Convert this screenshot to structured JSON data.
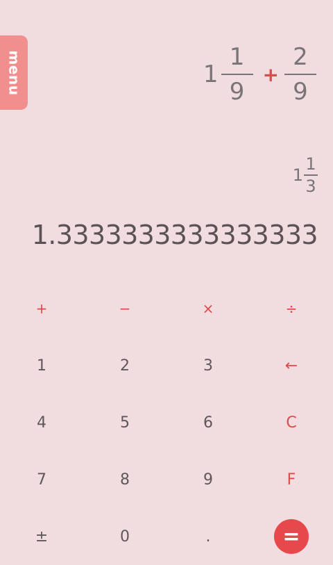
{
  "menu": {
    "label": "menu"
  },
  "expression": {
    "whole": "1",
    "first_num": "1",
    "first_den": "9",
    "operator": "+",
    "second_num": "2",
    "second_den": "9"
  },
  "result": {
    "fraction": {
      "whole": "1",
      "num": "1",
      "den": "3"
    },
    "decimal": "1.3333333333333333"
  },
  "keypad": {
    "rows": [
      [
        "+",
        "−",
        "×",
        "÷"
      ],
      [
        "1",
        "2",
        "3",
        "←"
      ],
      [
        "4",
        "5",
        "6",
        "C"
      ],
      [
        "7",
        "8",
        "9",
        "F"
      ],
      [
        "±",
        "0",
        ".",
        "="
      ]
    ]
  },
  "colors": {
    "background": "#f1dcdf",
    "accent": "#e0494b",
    "menu_tab": "#f08f8e"
  }
}
